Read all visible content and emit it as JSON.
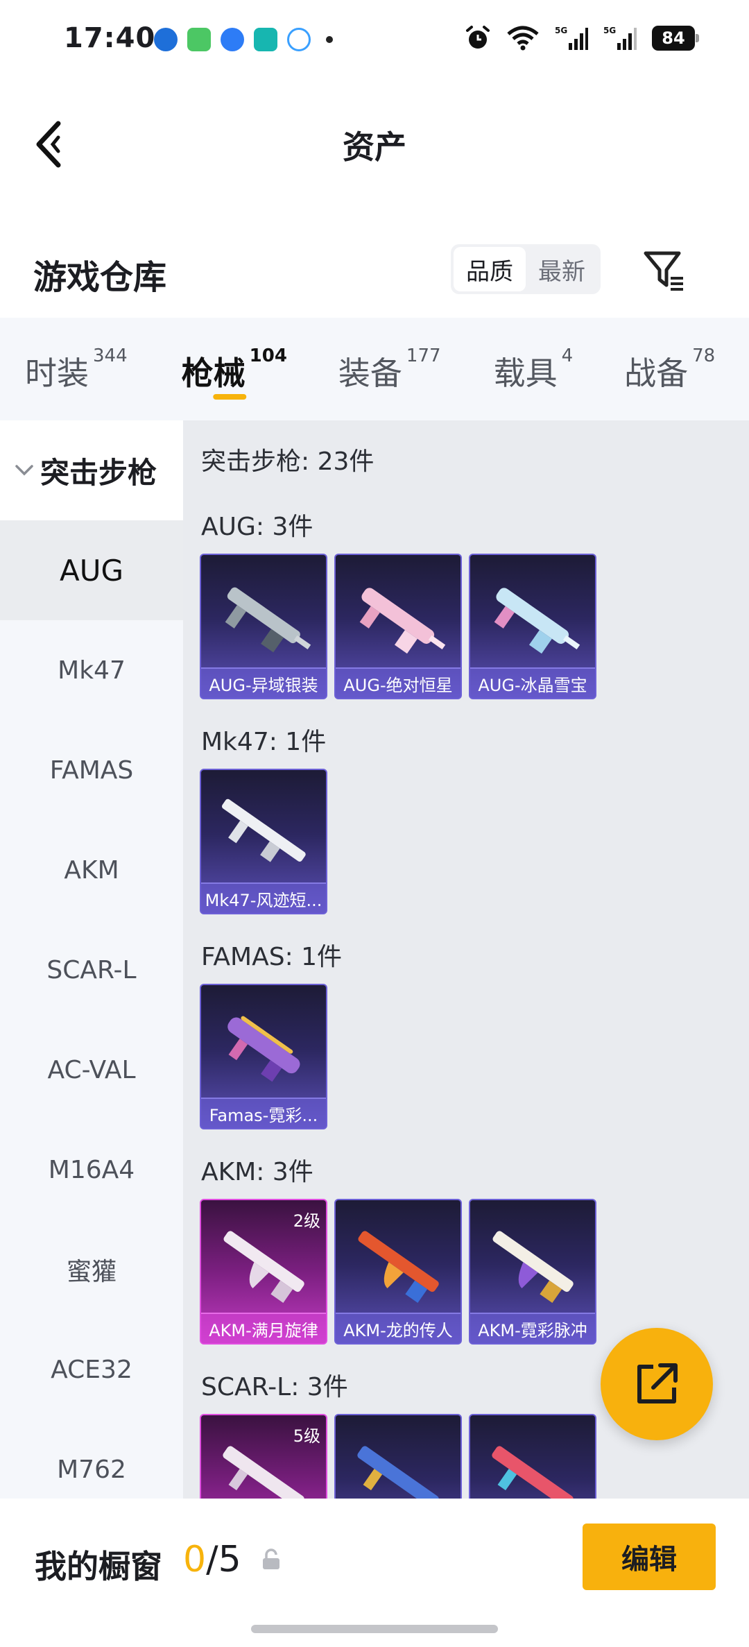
{
  "status_bar": {
    "time": "17:40",
    "battery": "84"
  },
  "header": {
    "title": "资产"
  },
  "section": {
    "title": "游戏仓库",
    "sort_options": [
      "品质",
      "最新"
    ]
  },
  "category_tabs": [
    {
      "label": "时装",
      "count": "344"
    },
    {
      "label": "枪械",
      "count": "104"
    },
    {
      "label": "装备",
      "count": "177"
    },
    {
      "label": "载具",
      "count": "4"
    },
    {
      "label": "战备",
      "count": "78"
    }
  ],
  "sidebar": {
    "group": "突击步枪",
    "items": [
      "AUG",
      "Mk47",
      "FAMAS",
      "AKM",
      "SCAR-L",
      "AC-VAL",
      "M16A4",
      "蜜獾",
      "ACE32",
      "M762"
    ]
  },
  "content": {
    "header": "突击步枪: 23件",
    "groups": [
      {
        "label": "AUG: 3件",
        "items": [
          {
            "name": "AUG-异域银装",
            "level": ""
          },
          {
            "name": "AUG-绝对恒星",
            "level": ""
          },
          {
            "name": "AUG-冰晶雪宝",
            "level": ""
          }
        ]
      },
      {
        "label": "Mk47: 1件",
        "items": [
          {
            "name": "Mk47-风迹短...",
            "level": ""
          }
        ]
      },
      {
        "label": "FAMAS: 1件",
        "items": [
          {
            "name": "Famas-霓彩...",
            "level": ""
          }
        ]
      },
      {
        "label": "AKM: 3件",
        "items": [
          {
            "name": "AKM-满月旋律",
            "level": "2级"
          },
          {
            "name": "AKM-龙的传人",
            "level": ""
          },
          {
            "name": "AKM-霓彩脉冲",
            "level": ""
          }
        ]
      },
      {
        "label": "SCAR-L: 3件",
        "items": [
          {
            "name": "",
            "level": "5级"
          },
          {
            "name": "",
            "level": ""
          },
          {
            "name": "",
            "level": ""
          }
        ]
      }
    ]
  },
  "bottom_bar": {
    "title": "我的橱窗",
    "current": "0",
    "total": "/5",
    "edit_label": "编辑"
  },
  "colors": {
    "accent": "#f8b10d",
    "card_purple": "#5b4fb6",
    "card_pink": "#c33bc3"
  }
}
